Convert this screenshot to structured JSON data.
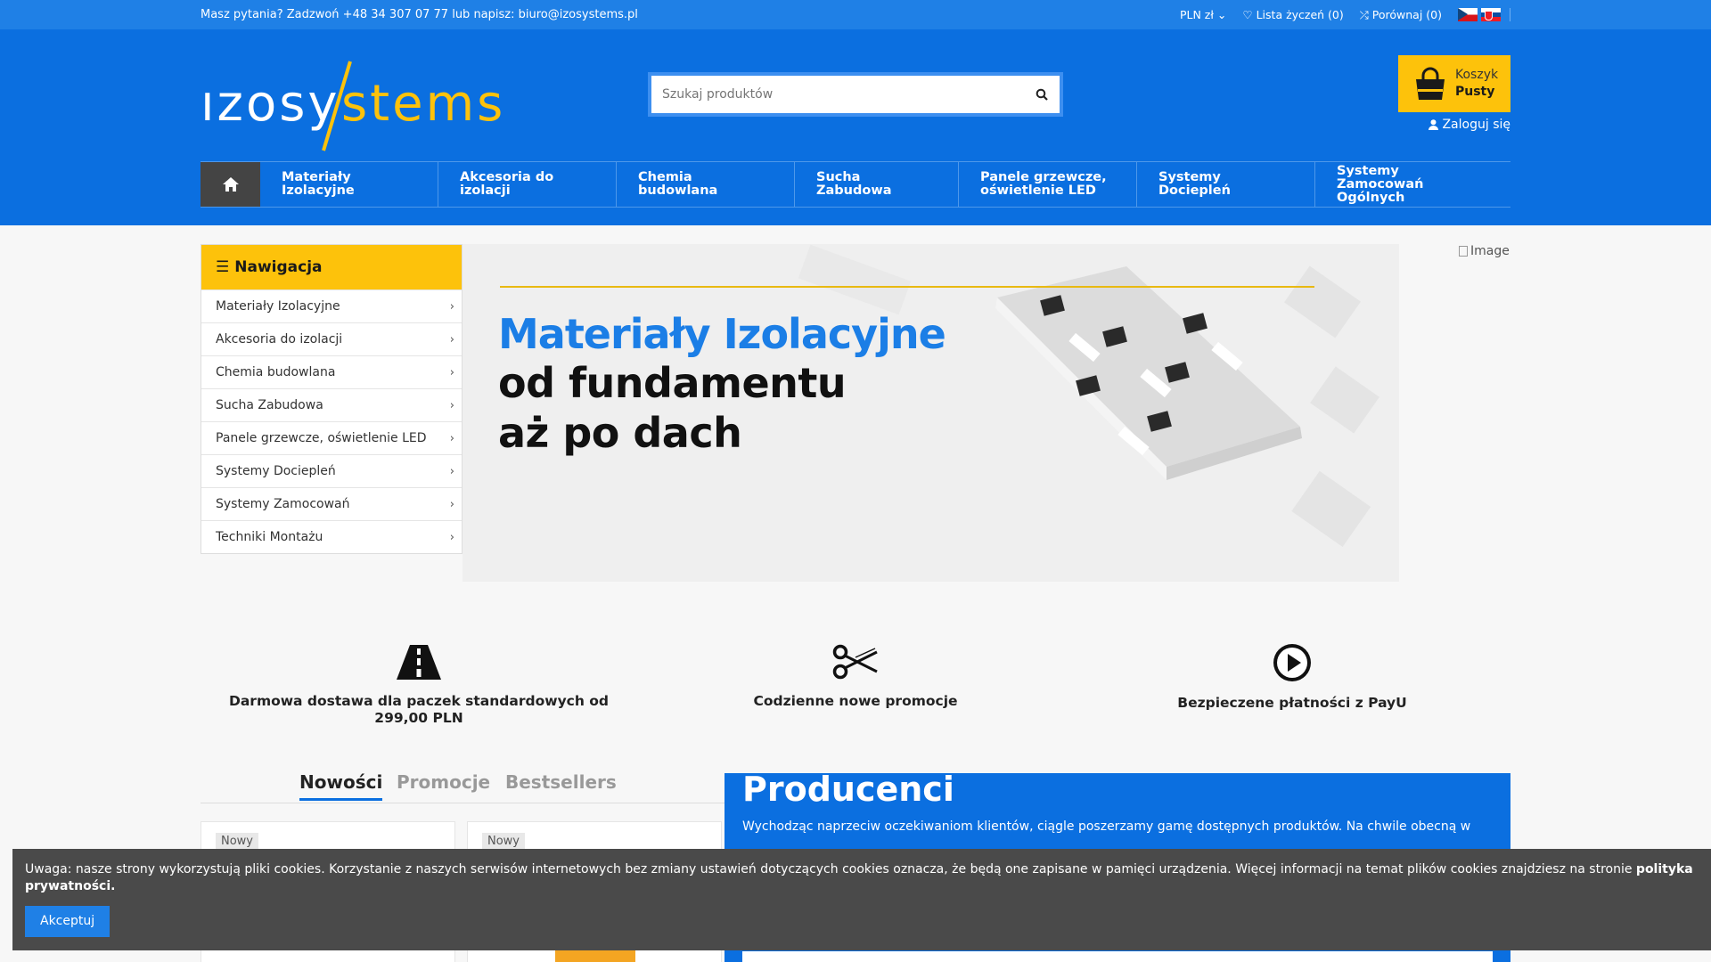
{
  "topbar": {
    "contact": "Masz pytania? Zadzwoń +48 34 307 07 77 lub napisz: biuro@izosystems.pl",
    "currency": "PLN zł",
    "wishlist": "Lista życzeń (0)",
    "compare": "Porównaj (0)"
  },
  "header": {
    "logo_left": "ızosy",
    "logo_right": "stems",
    "search_placeholder": "Szukaj produktów",
    "cart_label": "Koszyk",
    "cart_status": "Pusty",
    "login": "Zaloguj się"
  },
  "nav": {
    "items": [
      {
        "label": "Materiały Izolacyjne"
      },
      {
        "label": "Akcesoria do izolacji"
      },
      {
        "label": "Chemia budowlana"
      },
      {
        "label": "Sucha Zabudowa"
      },
      {
        "label": "Panele grzewcze, oświetlenie LED"
      },
      {
        "label": "Systemy Dociepleń"
      },
      {
        "label": "Systemy Zamocowań Ogólnych"
      }
    ]
  },
  "sidebar": {
    "title": "Nawigacja",
    "items": [
      {
        "label": "Materiały Izolacyjne"
      },
      {
        "label": "Akcesoria do izolacji"
      },
      {
        "label": "Chemia budowlana"
      },
      {
        "label": "Sucha Zabudowa"
      },
      {
        "label": "Panele grzewcze, oświetlenie LED"
      },
      {
        "label": "Systemy Dociepleń"
      },
      {
        "label": "Systemy Zamocowań"
      },
      {
        "label": "Techniki Montażu"
      }
    ]
  },
  "banner": {
    "title": "Materiały Izolacyjne",
    "line1": "od fundamentu",
    "line2": "aż po dach",
    "image_alt": "Image"
  },
  "features": [
    {
      "icon": "road-icon",
      "text": "Darmowa dostawa dla paczek standardowych od 299,00 PLN"
    },
    {
      "icon": "scissors-icon",
      "text": "Codzienne nowe promocje"
    },
    {
      "icon": "play-icon",
      "text": "Bezpieczene płatności z PayU"
    }
  ],
  "tabs": {
    "new": "Nowości",
    "promo": "Promocje",
    "best": "Bestsellers"
  },
  "products": [
    {
      "badge": "Nowy"
    },
    {
      "badge": "Nowy"
    }
  ],
  "producers": {
    "title": "Producenci",
    "text": "Wychodząc naprzeciw oczekiwaniom klientów, ciągle poszerzamy gamę dostępnych produktów. Na chwile obecną w"
  },
  "cookie": {
    "text": "Uwaga: nasze strony wykorzystują pliki cookies. Korzystanie z naszych serwisów internetowych bez zmiany ustawień dotyczących cookies oznacza, że będą one zapisane w pamięci urządzenia. Więcej informacji na temat plików cookies znajdziesz na stronie ",
    "link": "polityka prywatności.",
    "accept": "Akceptuj"
  },
  "colors": {
    "topbar": "#1f80e6",
    "header": "#0b6fe0",
    "accent_yellow": "#fdc20b",
    "banner_blue": "#1b7ee6"
  }
}
